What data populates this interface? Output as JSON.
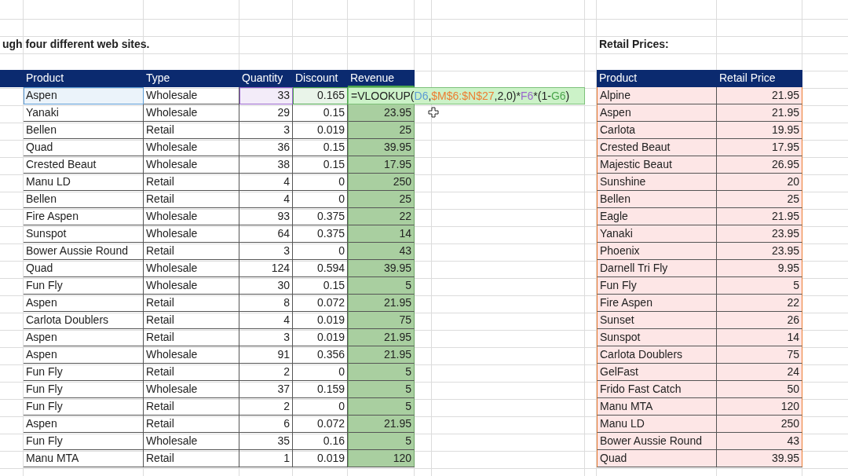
{
  "sheet": {
    "title_text": "ugh four different web sites.",
    "lookup_title": "Retail Prices:"
  },
  "orders": {
    "columns": [
      {
        "label": "Product",
        "selected": false
      },
      {
        "label": "Type",
        "selected": false
      },
      {
        "label": "Quantity",
        "selected": false
      },
      {
        "label": "Discount",
        "selected": false
      },
      {
        "label": "Revenue",
        "selected": true
      }
    ],
    "formula": [
      {
        "text": "=VLOOKUP("
      },
      {
        "text": "D6",
        "color": "#5b9bd5"
      },
      {
        "text": ","
      },
      {
        "text": "$M$6:$N$27",
        "color": "#ed7d31"
      },
      {
        "text": ",2,0)*"
      },
      {
        "text": "F6",
        "color": "#9966cc"
      },
      {
        "text": "*(1-"
      },
      {
        "text": "G6",
        "color": "#4ca64c"
      },
      {
        "text": ")"
      }
    ],
    "rows": [
      {
        "product": "Aspen",
        "type": "Wholesale",
        "quantity": "33",
        "discount": "0.165",
        "revenue": "",
        "editing": true
      },
      {
        "product": "Yanaki",
        "type": "Wholesale",
        "quantity": "29",
        "discount": "0.15",
        "revenue": "23.95",
        "editing": false
      },
      {
        "product": "Bellen",
        "type": "Retail",
        "quantity": "3",
        "discount": "0.019",
        "revenue": "25",
        "editing": false
      },
      {
        "product": "Quad",
        "type": "Wholesale",
        "quantity": "36",
        "discount": "0.15",
        "revenue": "39.95",
        "editing": false
      },
      {
        "product": "Crested Beaut",
        "type": "Wholesale",
        "quantity": "38",
        "discount": "0.15",
        "revenue": "17.95",
        "editing": false
      },
      {
        "product": "Manu LD",
        "type": "Retail",
        "quantity": "4",
        "discount": "0",
        "revenue": "250",
        "editing": false
      },
      {
        "product": "Bellen",
        "type": "Retail",
        "quantity": "4",
        "discount": "0",
        "revenue": "25",
        "editing": false
      },
      {
        "product": "Fire Aspen",
        "type": "Wholesale",
        "quantity": "93",
        "discount": "0.375",
        "revenue": "22",
        "editing": false
      },
      {
        "product": "Sunspot",
        "type": "Wholesale",
        "quantity": "64",
        "discount": "0.375",
        "revenue": "14",
        "editing": false
      },
      {
        "product": "Bower Aussie Round",
        "type": "Retail",
        "quantity": "3",
        "discount": "0",
        "revenue": "43",
        "editing": false
      },
      {
        "product": "Quad",
        "type": "Wholesale",
        "quantity": "124",
        "discount": "0.594",
        "revenue": "39.95",
        "editing": false
      },
      {
        "product": "Fun Fly",
        "type": "Wholesale",
        "quantity": "30",
        "discount": "0.15",
        "revenue": "5",
        "editing": false
      },
      {
        "product": "Aspen",
        "type": "Retail",
        "quantity": "8",
        "discount": "0.072",
        "revenue": "21.95",
        "editing": false
      },
      {
        "product": "Carlota Doublers",
        "type": "Retail",
        "quantity": "4",
        "discount": "0.019",
        "revenue": "75",
        "editing": false
      },
      {
        "product": "Aspen",
        "type": "Retail",
        "quantity": "3",
        "discount": "0.019",
        "revenue": "21.95",
        "editing": false
      },
      {
        "product": "Aspen",
        "type": "Wholesale",
        "quantity": "91",
        "discount": "0.356",
        "revenue": "21.95",
        "editing": false
      },
      {
        "product": "Fun Fly",
        "type": "Retail",
        "quantity": "2",
        "discount": "0",
        "revenue": "5",
        "editing": false
      },
      {
        "product": "Fun Fly",
        "type": "Wholesale",
        "quantity": "37",
        "discount": "0.159",
        "revenue": "5",
        "editing": false
      },
      {
        "product": "Fun Fly",
        "type": "Retail",
        "quantity": "2",
        "discount": "0",
        "revenue": "5",
        "editing": false
      },
      {
        "product": "Aspen",
        "type": "Retail",
        "quantity": "6",
        "discount": "0.072",
        "revenue": "21.95",
        "editing": false
      },
      {
        "product": "Fun Fly",
        "type": "Wholesale",
        "quantity": "35",
        "discount": "0.16",
        "revenue": "5",
        "editing": false
      },
      {
        "product": "Manu MTA",
        "type": "Retail",
        "quantity": "1",
        "discount": "0.019",
        "revenue": "120",
        "editing": false
      }
    ]
  },
  "prices": {
    "columns": [
      "Product",
      "Retail Price"
    ],
    "rows": [
      {
        "product": "Alpine",
        "price": "21.95"
      },
      {
        "product": "Aspen",
        "price": "21.95"
      },
      {
        "product": "Carlota",
        "price": "19.95"
      },
      {
        "product": "Crested Beaut",
        "price": "17.95"
      },
      {
        "product": "Majestic Beaut",
        "price": "26.95"
      },
      {
        "product": "Sunshine",
        "price": "20"
      },
      {
        "product": "Bellen",
        "price": "25"
      },
      {
        "product": "Eagle",
        "price": "21.95"
      },
      {
        "product": "Yanaki",
        "price": "23.95"
      },
      {
        "product": "Phoenix",
        "price": "23.95"
      },
      {
        "product": "Darnell Tri Fly",
        "price": "9.95"
      },
      {
        "product": "Fun Fly",
        "price": "5"
      },
      {
        "product": "Fire Aspen",
        "price": "22"
      },
      {
        "product": "Sunset",
        "price": "26"
      },
      {
        "product": "Sunspot",
        "price": "14"
      },
      {
        "product": "Carlota Doublers",
        "price": "75"
      },
      {
        "product": "GelFast",
        "price": "24"
      },
      {
        "product": "Frido Fast Catch",
        "price": "50"
      },
      {
        "product": "Manu MTA",
        "price": "120"
      },
      {
        "product": "Manu LD",
        "price": "250"
      },
      {
        "product": "Bower Aussie Round",
        "price": "43"
      },
      {
        "product": "Quad",
        "price": "39.95"
      }
    ]
  }
}
